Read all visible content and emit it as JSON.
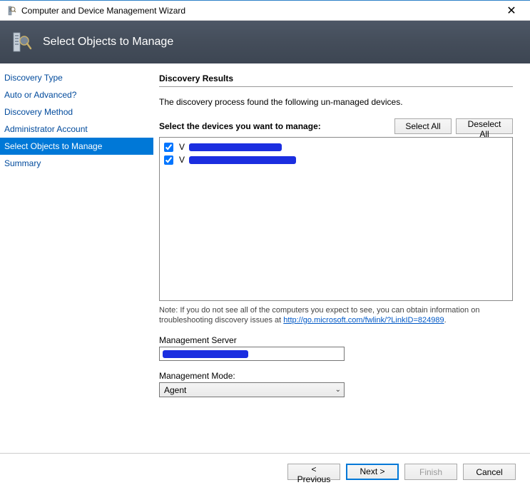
{
  "window": {
    "title": "Computer and Device Management Wizard"
  },
  "header": {
    "heading": "Select Objects to Manage"
  },
  "sidebar": {
    "items": [
      {
        "label": "Discovery Type",
        "active": false
      },
      {
        "label": "Auto or Advanced?",
        "active": false
      },
      {
        "label": "Discovery Method",
        "active": false
      },
      {
        "label": "Administrator Account",
        "active": false
      },
      {
        "label": "Select Objects to Manage",
        "active": true
      },
      {
        "label": "Summary",
        "active": false
      }
    ]
  },
  "main": {
    "section_title": "Discovery Results",
    "intro": "The discovery process found the following un-managed devices.",
    "select_prompt": "Select the devices you want to manage:",
    "select_all": "Select All",
    "deselect_all": "Deselect All",
    "devices": [
      {
        "checked": true,
        "label": "V"
      },
      {
        "checked": true,
        "label": "V"
      }
    ],
    "note_prefix": "Note: If you do not see all of the computers you expect to see, you can obtain information on troubleshooting discovery issues at ",
    "note_link_text": "http://go.microsoft.com/fwlink/?LinkID=824989",
    "note_suffix": ".",
    "mgmt_server_label": "Management Server",
    "mgmt_server_value": "",
    "mgmt_mode_label": "Management Mode:",
    "mgmt_mode_value": "Agent"
  },
  "footer": {
    "previous": "< Previous",
    "next": "Next >",
    "finish": "Finish",
    "cancel": "Cancel"
  }
}
